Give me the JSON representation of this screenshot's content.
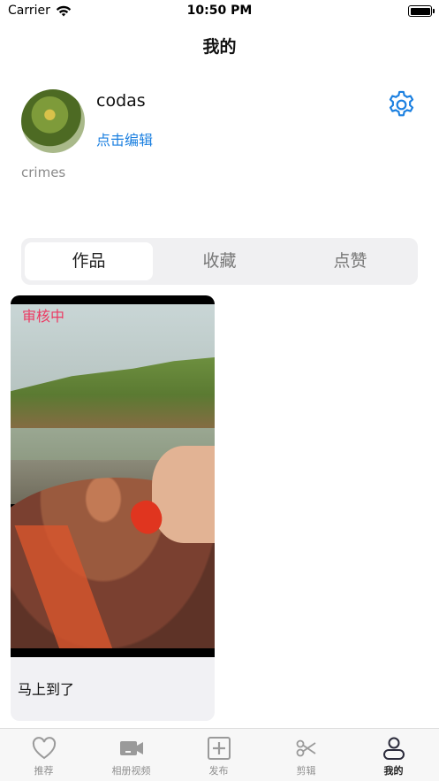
{
  "status": {
    "carrier": "Carrier",
    "time": "10:50 PM"
  },
  "nav": {
    "title": "我的"
  },
  "profile": {
    "username": "codas",
    "edit_label": "点击编辑",
    "bio": "crimes"
  },
  "tabs": [
    {
      "label": "作品",
      "active": true
    },
    {
      "label": "收藏",
      "active": false
    },
    {
      "label": "点赞",
      "active": false
    }
  ],
  "works": [
    {
      "status_badge": "审核中",
      "status_color": "#ec3a63",
      "caption": "马上到了"
    }
  ],
  "tabbar": [
    {
      "label": "推荐",
      "icon": "heart-icon",
      "active": false
    },
    {
      "label": "相册视频",
      "icon": "video-camera-icon",
      "active": false
    },
    {
      "label": "发布",
      "icon": "plus-square-icon",
      "active": false
    },
    {
      "label": "剪辑",
      "icon": "scissors-icon",
      "active": false
    },
    {
      "label": "我的",
      "icon": "person-icon",
      "active": true
    }
  ],
  "colors": {
    "accent_blue": "#1a7fe0",
    "badge_pink": "#ec3a63"
  }
}
